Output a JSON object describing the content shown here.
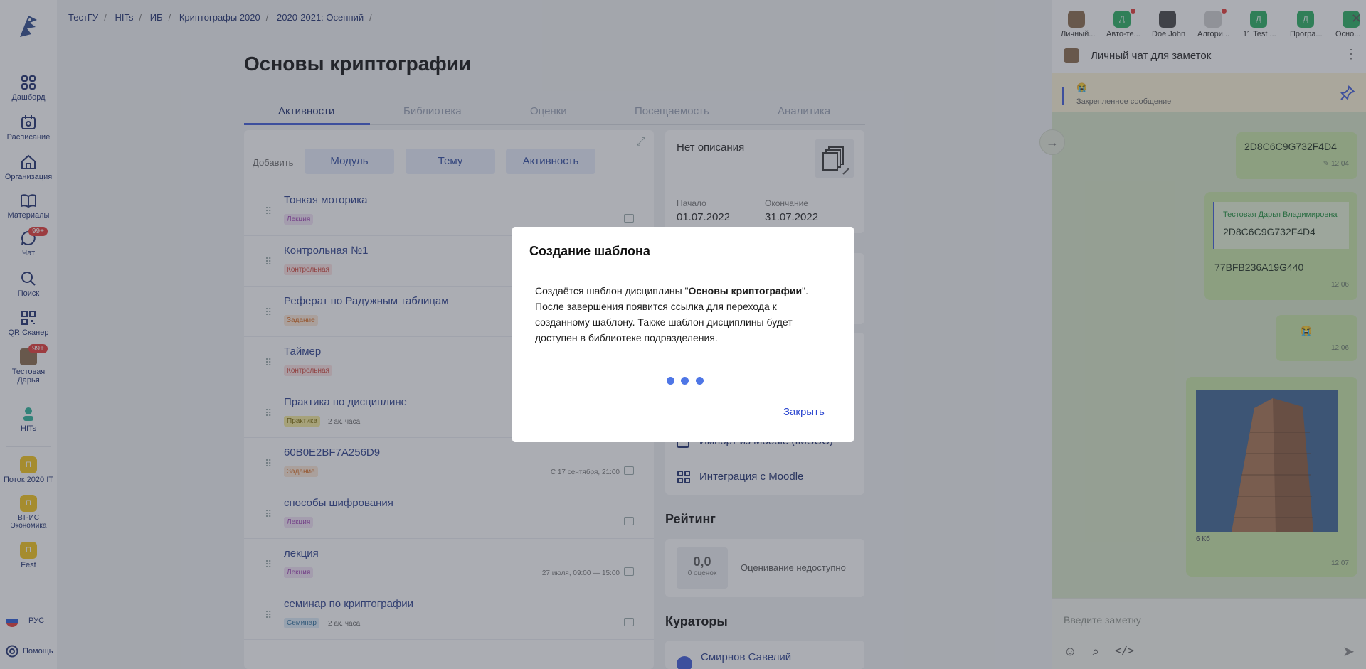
{
  "breadcrumb": [
    "ТестГУ",
    "HITs",
    "ИБ",
    "Криптографы 2020",
    "2020-2021: Осенний"
  ],
  "sidebar": {
    "items": [
      {
        "label": "Дашборд",
        "icon": "grid-icon"
      },
      {
        "label": "Расписание",
        "icon": "calendar-icon"
      },
      {
        "label": "Организация",
        "icon": "home-icon"
      },
      {
        "label": "Материалы",
        "icon": "book-icon"
      },
      {
        "label": "Чат",
        "icon": "chat-icon",
        "badge": "99+"
      },
      {
        "label": "Поиск",
        "icon": "search-icon"
      },
      {
        "label": "QR Сканер",
        "icon": "qr-icon"
      },
      {
        "label": "Тестовая Дарья",
        "icon": "avatar-icon",
        "badge": "99+"
      },
      {
        "label": "HITs",
        "icon": "hits-icon"
      }
    ],
    "spaces": [
      {
        "letter": "П",
        "label": "Поток 2020 IT"
      },
      {
        "letter": "П",
        "label": "ВТ-ИС Экономика"
      },
      {
        "letter": "П",
        "label": "Fest"
      }
    ],
    "language": "РУС",
    "help": "Помощь"
  },
  "course": {
    "title": "Основы криптографии",
    "tabs": [
      "Активности",
      "Библиотека",
      "Оценки",
      "Посещаемость",
      "Аналитика"
    ],
    "add_label": "Добавить",
    "add_buttons": [
      "Модуль",
      "Тему",
      "Активность"
    ],
    "activities": [
      {
        "name": "Тонкая моторика",
        "tag": "Лекция",
        "cls": "tg-lec",
        "meta": ""
      },
      {
        "name": "Контрольная №1",
        "tag": "Контрольная",
        "cls": "tg-ctl",
        "meta": ""
      },
      {
        "name": "Реферат по Радужным таблицам",
        "tag": "Задание",
        "cls": "tg-task",
        "meta": ""
      },
      {
        "name": "Таймер",
        "tag": "Контрольная",
        "cls": "tg-ctl",
        "meta": ""
      },
      {
        "name": "Практика по дисциплине",
        "tag": "Практика",
        "cls": "tg-prac",
        "duration": "2 ак. часа",
        "meta": ""
      },
      {
        "name": "60B0E2BF7A256D9",
        "tag": "Задание",
        "cls": "tg-task",
        "meta": "С 17 сентября, 21:00"
      },
      {
        "name": "способы шифрования",
        "tag": "Лекция",
        "cls": "tg-lec",
        "meta": ""
      },
      {
        "name": "лекция",
        "tag": "Лекция",
        "cls": "tg-lec",
        "meta": "27 июля, 09:00 — 15:00"
      },
      {
        "name": "семинар по криптографии",
        "tag": "Семинар",
        "cls": "tg-sem",
        "duration": "2 ак. часа",
        "meta": ""
      }
    ]
  },
  "info": {
    "description": "Нет описания",
    "start_label": "Начало",
    "start": "01.07.2022",
    "end_label": "Окончание",
    "end": "31.07.2022",
    "moodle_import": "Импорт из Moodle (IMSCC)",
    "moodle_integration": "Интеграция с Moodle",
    "rating_title": "Рейтинг",
    "rating_value": "0,0",
    "rating_count": "0 оценок",
    "rating_status": "Оценивание недоступно",
    "curators_title": "Кураторы",
    "curator": "Смирнов Савелий"
  },
  "chat": {
    "contacts": [
      {
        "label": "Личный...",
        "color": "#8a6a4a",
        "letter": ""
      },
      {
        "label": "Авто-те...",
        "color": "#27ae60",
        "letter": "Д"
      },
      {
        "label": "Doe John",
        "color": "#444444",
        "letter": ""
      },
      {
        "label": "Алгори...",
        "color": "#d0d0d0",
        "letter": ""
      },
      {
        "label": "11 Test ...",
        "color": "#27ae60",
        "letter": "Д"
      },
      {
        "label": "Програ...",
        "color": "#27ae60",
        "letter": "Д"
      },
      {
        "label": "Осно...",
        "color": "#27ae60",
        "letter": ""
      }
    ],
    "title": "Личный чат для заметок",
    "pinned_label": "Закрепленное сообщение",
    "messages": [
      {
        "text": "2D8C6C9G732F4D4",
        "time": "12:04"
      },
      {
        "reply_author": "Тестовая Дарья Владимировна",
        "reply_text": "2D8C6C9G732F4D4",
        "text": "77BFB236A19G440",
        "time": "12:06"
      },
      {
        "text": "😭",
        "time": "12:06"
      },
      {
        "file_size": "6 Кб",
        "time": "12:07"
      }
    ],
    "input_placeholder": "Введите заметку"
  },
  "modal": {
    "title": "Создание шаблона",
    "body_before": "Создаётся шаблон дисциплины \"",
    "body_bold": "Основы криптографии",
    "body_after": "\". После завершения появится ссылка для перехода к созданному шаблону. Также шаблон дисциплины будет доступен в библиотеке подразделения.",
    "close": "Закрыть"
  }
}
